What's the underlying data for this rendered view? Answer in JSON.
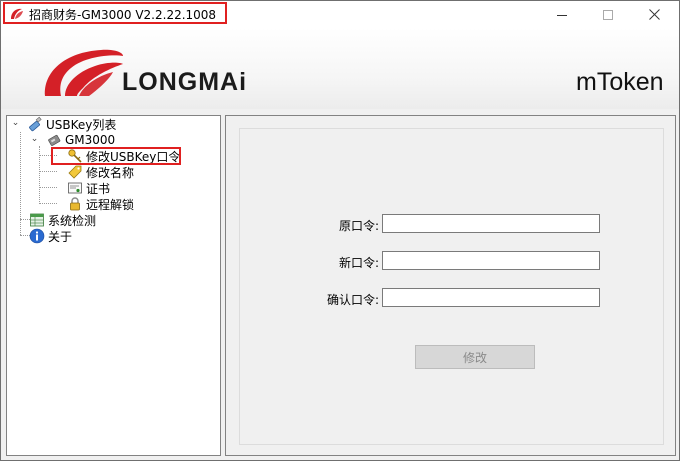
{
  "window": {
    "title": "招商财务-GM3000  V2.2.22.1008",
    "minimize_icon": "minimize-icon",
    "maximize_icon": "maximize-icon",
    "close_icon": "close-icon"
  },
  "banner": {
    "brand": "LONGMAi",
    "product": "mToken"
  },
  "tree": {
    "root": {
      "label": "USBKey列表",
      "icon": "usb-key-icon"
    },
    "device": {
      "label": "GM3000",
      "icon": "device-icon"
    },
    "children": [
      {
        "label": "修改USBKey口令",
        "icon": "key-icon"
      },
      {
        "label": "修改名称",
        "icon": "tag-icon"
      },
      {
        "label": "证书",
        "icon": "certificate-icon"
      },
      {
        "label": "远程解锁",
        "icon": "lock-icon"
      }
    ],
    "system_check": {
      "label": "系统检测",
      "icon": "table-icon"
    },
    "about": {
      "label": "关于",
      "icon": "info-icon"
    }
  },
  "form": {
    "old_password_label": "原口令:",
    "old_password_value": "",
    "new_password_label": "新口令:",
    "new_password_value": "",
    "confirm_password_label": "确认口令:",
    "confirm_password_value": "",
    "submit_label": "修改"
  },
  "colors": {
    "highlight_border": "#e02020",
    "brand_red": "#d42027"
  }
}
